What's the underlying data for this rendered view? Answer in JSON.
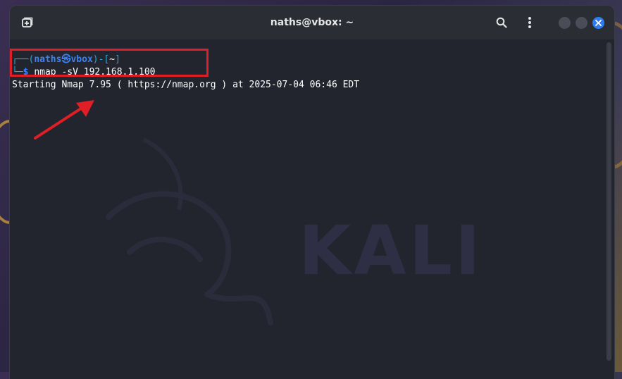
{
  "window": {
    "title": "naths@vbox: ~"
  },
  "terminal": {
    "prompt_user": "naths",
    "prompt_symbol": "㉿",
    "prompt_host": "vbox",
    "prompt_dir": "~",
    "prompt_prefix_open": "┌──(",
    "prompt_prefix_close": ")-[",
    "prompt_prefix_end": "]",
    "prompt_line2": "└─",
    "prompt_dollar": "$",
    "command": "nmap -sV 192.168.1.100",
    "output_line1": "Starting Nmap 7.95 ( https://nmap.org ) at 2025-07-04 06:46 EDT"
  },
  "watermark": "KALI",
  "colors": {
    "terminal_bg": "#22252e",
    "prompt_blue": "#3b82f6",
    "prompt_teal": "#2aa6d6",
    "annotation_red": "#e01e25",
    "close_button": "#2f7cf0"
  },
  "icons": [
    "new-tab-icon",
    "search-icon",
    "kebab-menu-icon",
    "minimize-icon",
    "maximize-icon",
    "close-icon"
  ]
}
